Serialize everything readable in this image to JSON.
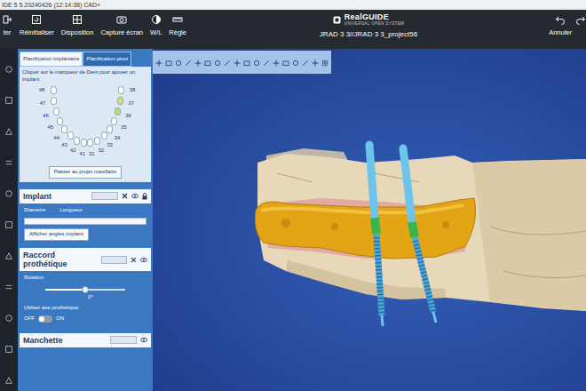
{
  "window": {
    "title": "IDE 5 5.20240426 (12:14:38) CAD+"
  },
  "toolbar": {
    "items": [
      {
        "label": "ter"
      },
      {
        "label": "Réinitialiser"
      },
      {
        "label": "Disposition"
      },
      {
        "label": "Capture écran"
      },
      {
        "label": "W/L"
      },
      {
        "label": "Règle"
      }
    ],
    "logo": {
      "brand": "RealGUIDE",
      "tagline": "UNIVERSAL OPEN SYSTEM"
    },
    "right": [
      {
        "label": "Annuler"
      }
    ]
  },
  "project": {
    "title": "JRAD 3 3//JRAD 3 3_project56"
  },
  "panel": {
    "tabs": [
      {
        "label": "Planification implantaire",
        "selected": true
      },
      {
        "label": "Planification pivot",
        "selected": false
      }
    ],
    "hint": "Cliquer sur le marqueur de Dent pour ajouter un implant",
    "teeth": [
      {
        "number": "48",
        "color": "#ffffff"
      },
      {
        "number": "47",
        "color": "#ffffff"
      },
      {
        "number": "46",
        "color": "#ffffff"
      },
      {
        "number": "45",
        "color": "#ffffff"
      },
      {
        "number": "44",
        "color": "#ffffff"
      },
      {
        "number": "43",
        "color": "#ffffff"
      },
      {
        "number": "42",
        "color": "#ffffff"
      },
      {
        "number": "41",
        "color": "#ffffff"
      },
      {
        "number": "31",
        "color": "#ffffff"
      },
      {
        "number": "32",
        "color": "#ffffff"
      },
      {
        "number": "33",
        "color": "#ffffff"
      },
      {
        "number": "34",
        "color": "#ffffff"
      },
      {
        "number": "35",
        "color": "#ffffff"
      },
      {
        "number": "36",
        "color": "#b7dc7a"
      },
      {
        "number": "37",
        "color": "#d9e36a"
      },
      {
        "number": "38",
        "color": "#ffffff"
      }
    ],
    "jaw_button": "Passer au projet maxillaire",
    "implant": {
      "title": "Implant",
      "fields": [
        "Diametre",
        "Longueur"
      ],
      "button": "Afficher angles implant"
    },
    "connector": {
      "title": "Raccord prothétique",
      "rotation": {
        "label": "Rotation",
        "level": 0.5,
        "reading": "0°"
      },
      "axis_label": "Utiliser axe prothétique",
      "toggle": {
        "off": "OFF",
        "on": "ON",
        "checked": false
      }
    },
    "sleeve": {
      "title": "Manchette"
    }
  }
}
